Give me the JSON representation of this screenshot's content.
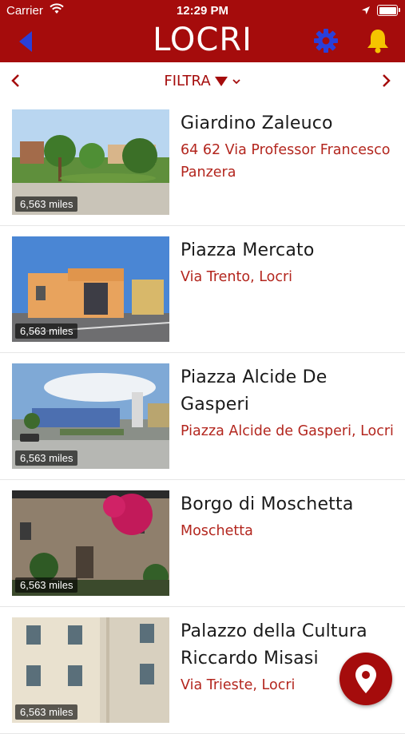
{
  "status_bar": {
    "carrier": "Carrier",
    "time": "12:29 PM"
  },
  "navbar": {
    "title": "LOCRI"
  },
  "filter_bar": {
    "filter_label": "FILTRA"
  },
  "places": [
    {
      "name": "Giardino Zaleuco",
      "address": "64 62 Via Professor Francesco Panzera",
      "distance": "6,563 miles"
    },
    {
      "name": "Piazza Mercato",
      "address": "Via Trento, Locri",
      "distance": "6,563 miles"
    },
    {
      "name": "Piazza Alcide De Gasperi",
      "address": "Piazza Alcide de Gasperi, Locri",
      "distance": "6,563 miles"
    },
    {
      "name": "Borgo di Moschetta",
      "address": "Moschetta",
      "distance": "6,563 miles"
    },
    {
      "name": "Palazzo della Cultura Riccardo Misasi",
      "address": "Via Trieste, Locri",
      "distance": "6,563 miles"
    }
  ],
  "colors": {
    "brand": "#a50c0c",
    "address_text": "#b3261e",
    "back_icon": "#2a3fd9",
    "gear_icon": "#2a3fd9",
    "bell_icon": "#f5c400"
  }
}
